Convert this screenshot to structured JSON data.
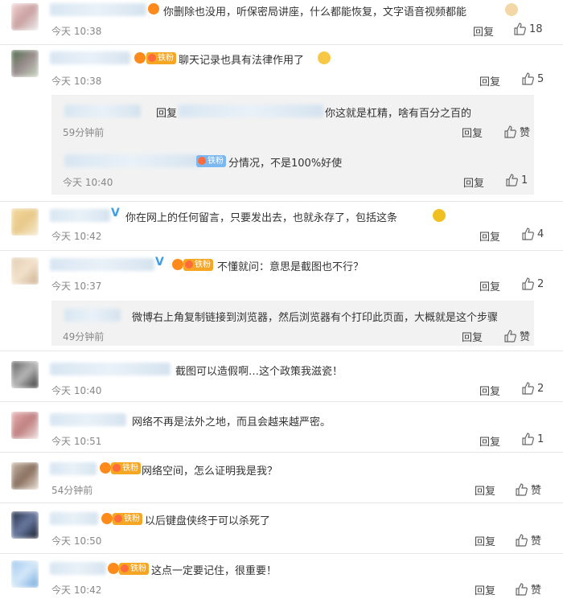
{
  "reply_label": "回复",
  "comments": [
    {
      "text": "你删除也没用，听保密局讲座，什么都能恢复，文字语音视频都能",
      "time": "今天 10:38",
      "likes": "18"
    },
    {
      "text": "聊天记录也具有法律作用了",
      "time": "今天 10:38",
      "likes": "5",
      "replies": [
        {
          "prefix": "回复",
          "text": "你这就是杠精，啥有百分之百的",
          "time": "59分钟前",
          "likes": "赞"
        },
        {
          "fan": "铁粉",
          "text": "分情况，不是100%好使",
          "time": "今天 10:40",
          "likes": "1"
        }
      ]
    },
    {
      "text": "你在网上的任何留言，只要发出去，也就永存了，包括这条",
      "time": "今天 10:42",
      "likes": "4"
    },
    {
      "fan": "铁粉",
      "text": "不懂就问：意思是截图也不行？",
      "time": "今天 10:37",
      "likes": "2",
      "replies": [
        {
          "text": "微博右上角复制链接到浏览器，然后浏览器有个打印此页面，大概就是这个步骤",
          "time": "49分钟前",
          "likes": "赞"
        }
      ]
    },
    {
      "text": "截图可以造假啊…这个政策我滋瓷！",
      "time": "今天 10:40",
      "likes": "2"
    },
    {
      "text": "网络不再是法外之地，而且会越来越严密。",
      "time": "今天 10:51",
      "likes": "1"
    },
    {
      "fan": "铁粉",
      "text": "网络空间，怎么证明我是我？",
      "time": "54分钟前",
      "likes": "赞"
    },
    {
      "fan": "铁粉",
      "text": "以后键盘侠终于可以杀死了",
      "time": "今天 10:50",
      "likes": "赞"
    },
    {
      "fan": "铁粉",
      "text": "这点一定要记住，很重要！",
      "time": "今天 10:42",
      "likes": "赞"
    }
  ]
}
